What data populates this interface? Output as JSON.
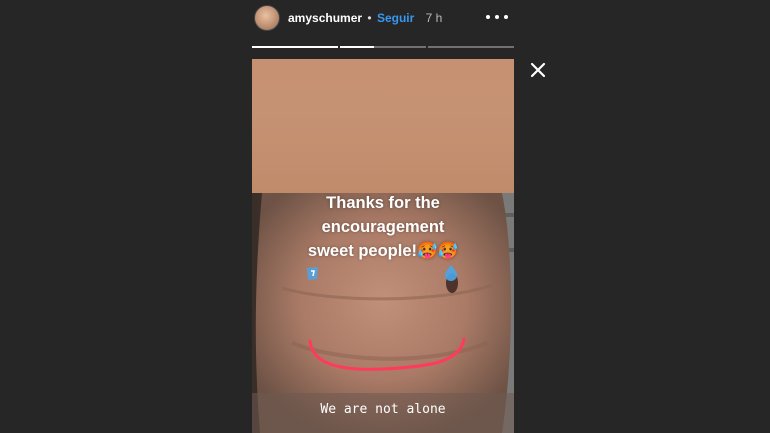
{
  "header": {
    "username": "amyschumer",
    "separator": "•",
    "follow_label": "Seguir",
    "timestamp": "7 h",
    "more_icon": "more-horizontal-icon"
  },
  "progress": {
    "segments": [
      {
        "state": "viewed",
        "fill_fraction": 1.0
      },
      {
        "state": "current",
        "fill_fraction": 0.4
      },
      {
        "state": "upcoming",
        "fill_fraction": 0.0
      }
    ]
  },
  "story": {
    "text_lines": [
      "Thanks for the",
      "encouragement",
      "sweet people!🥵🥵"
    ],
    "caption": "We are not alone",
    "sticker_icon": "water-drop-icon",
    "drawing_color": "#ff3b5c"
  },
  "close_icon": "close-icon",
  "colors": {
    "background": "#262626",
    "follow_link": "#3897f0"
  }
}
